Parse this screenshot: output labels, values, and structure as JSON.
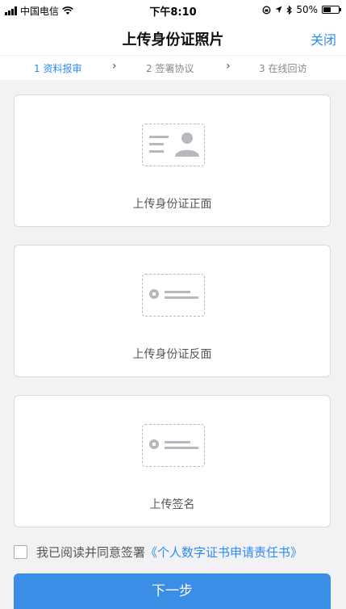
{
  "status_bar": {
    "carrier": "中国电信",
    "time": "下午8:10",
    "battery": "50%",
    "battery_level": 0.5
  },
  "header": {
    "title": "上传身份证照片",
    "close_label": "关闭"
  },
  "steps": [
    {
      "label": "1 资料报审",
      "active": true
    },
    {
      "label": "2 签署协议",
      "active": false
    },
    {
      "label": "3 在线回访",
      "active": false
    }
  ],
  "cards": [
    {
      "label": "上传身份证正面"
    },
    {
      "label": "上传身份证反面"
    },
    {
      "label": "上传签名"
    }
  ],
  "agreement": {
    "text": "我已阅读并同意签署",
    "link": "《个人数字证书申请责任书》",
    "checked": false
  },
  "next_button": {
    "label": "下一步"
  },
  "colors": {
    "accent": "#2d8cf0",
    "button": "#3a8ee6",
    "icon_gray": "#b8b8be"
  }
}
